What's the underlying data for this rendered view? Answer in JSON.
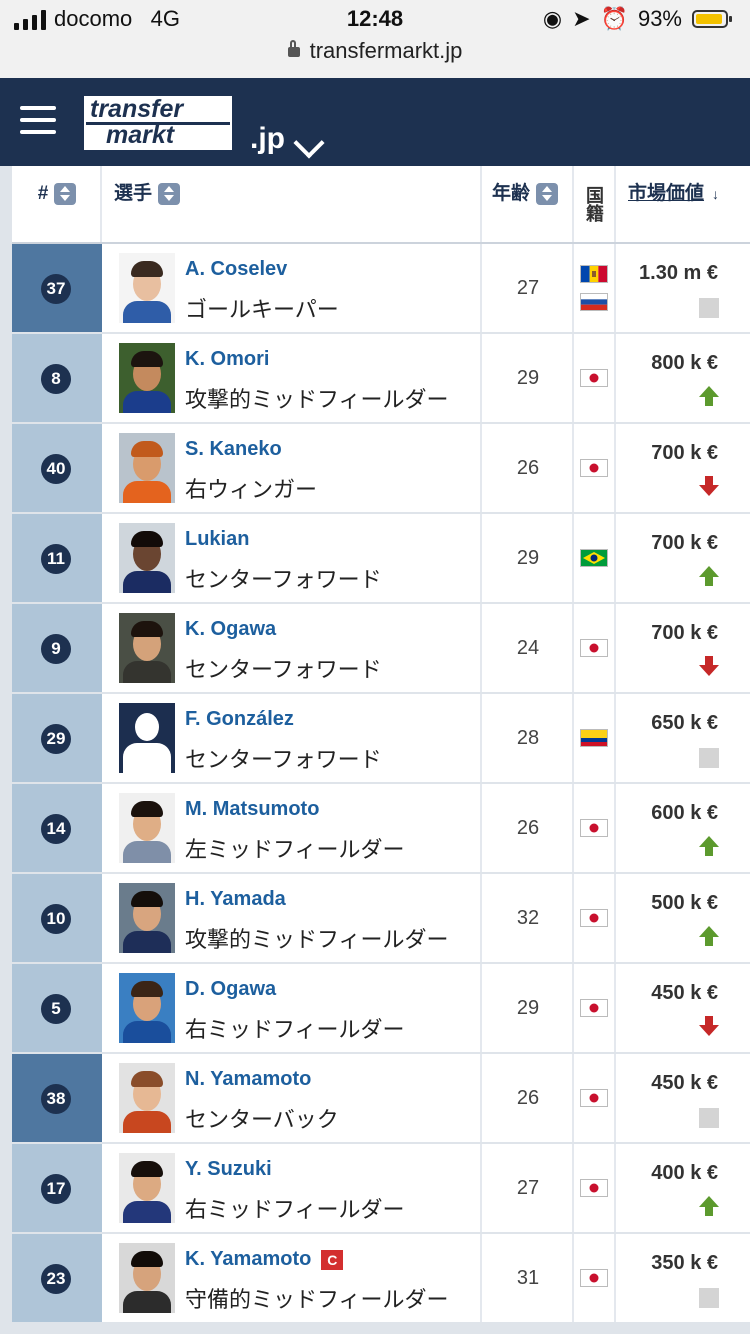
{
  "status_bar": {
    "carrier": "docomo",
    "network": "4G",
    "time": "12:48",
    "battery": "93%",
    "battery_level": 0.93
  },
  "browser": {
    "url": "transfermarkt.jp"
  },
  "site": {
    "logo_line1": "transfer",
    "logo_line2": "markt",
    "domain_suffix": ".jp"
  },
  "table": {
    "headers": {
      "number": "#",
      "player": "選手",
      "age": "年齢",
      "nationality": "国籍",
      "market_value": "市場価値"
    },
    "players": [
      {
        "number": "37",
        "name": "A. Coselev",
        "position": "ゴールキーパー",
        "age": "27",
        "flags": [
          "moldova",
          "russia"
        ],
        "value": "1.30 m €",
        "trend": "same",
        "row_color": "#4f77a0",
        "photo": {
          "bg": "#f4f4f4",
          "skin": "#e8bfa0",
          "hair": "#3a2a20",
          "shirt": "#2f5da8"
        }
      },
      {
        "number": "8",
        "name": "K. Omori",
        "position": "攻撃的ミッドフィールダー",
        "age": "29",
        "flags": [
          "japan"
        ],
        "value": "800 k €",
        "trend": "up",
        "row_color": "#afc5d8",
        "photo": {
          "bg": "#3d5f2e",
          "skin": "#c48a5e",
          "hair": "#1c140f",
          "shirt": "#1b3d8c"
        }
      },
      {
        "number": "40",
        "name": "S. Kaneko",
        "position": "右ウィンガー",
        "age": "26",
        "flags": [
          "japan"
        ],
        "value": "700 k €",
        "trend": "down",
        "row_color": "#afc5d8",
        "photo": {
          "bg": "#b9c3cc",
          "skin": "#d99b6c",
          "hair": "#c15a1c",
          "shirt": "#e4631e"
        }
      },
      {
        "number": "11",
        "name": "Lukian",
        "position": "センターフォワード",
        "age": "29",
        "flags": [
          "brazil"
        ],
        "value": "700 k €",
        "trend": "up",
        "row_color": "#afc5d8",
        "photo": {
          "bg": "#cfd6dc",
          "skin": "#6a4531",
          "hair": "#120b08",
          "shirt": "#1b2c62"
        }
      },
      {
        "number": "9",
        "name": "K. Ogawa",
        "position": "センターフォワード",
        "age": "24",
        "flags": [
          "japan"
        ],
        "value": "700 k €",
        "trend": "down",
        "row_color": "#afc5d8",
        "photo": {
          "bg": "#4a4f45",
          "skin": "#d4a27a",
          "hair": "#1d130d",
          "shirt": "#34342f"
        }
      },
      {
        "number": "29",
        "name": "F. González",
        "position": "センターフォワード",
        "age": "28",
        "flags": [
          "colombia"
        ],
        "value": "650 k €",
        "trend": "same",
        "row_color": "#afc5d8",
        "photo": {
          "bg": "#1c2e4f",
          "skin": "#ffffff",
          "hair": "#ffffff",
          "shirt": "#ffffff"
        }
      },
      {
        "number": "14",
        "name": "M. Matsumoto",
        "position": "左ミッドフィールダー",
        "age": "26",
        "flags": [
          "japan"
        ],
        "value": "600 k €",
        "trend": "up",
        "row_color": "#afc5d8",
        "photo": {
          "bg": "#f0f0f0",
          "skin": "#dfae86",
          "hair": "#1b120d",
          "shirt": "#7f8fa8"
        }
      },
      {
        "number": "10",
        "name": "H. Yamada",
        "position": "攻撃的ミッドフィールダー",
        "age": "32",
        "flags": [
          "japan"
        ],
        "value": "500 k €",
        "trend": "up",
        "row_color": "#afc5d8",
        "photo": {
          "bg": "#6a7c8c",
          "skin": "#d8a57f",
          "hair": "#140e0a",
          "shirt": "#1e2e58"
        }
      },
      {
        "number": "5",
        "name": "D. Ogawa",
        "position": "右ミッドフィールダー",
        "age": "29",
        "flags": [
          "japan"
        ],
        "value": "450 k €",
        "trend": "down",
        "row_color": "#afc5d8",
        "photo": {
          "bg": "#3a7fc2",
          "skin": "#d9a27a",
          "hair": "#3b2516",
          "shirt": "#1a4e9c"
        }
      },
      {
        "number": "38",
        "name": "N. Yamamoto",
        "position": "センターバック",
        "age": "26",
        "flags": [
          "japan"
        ],
        "value": "450 k €",
        "trend": "same",
        "row_color": "#4f77a0",
        "photo": {
          "bg": "#e2e2e2",
          "skin": "#e6b894",
          "hair": "#8a4d2a",
          "shirt": "#c8471f"
        }
      },
      {
        "number": "17",
        "name": "Y. Suzuki",
        "position": "右ミッドフィールダー",
        "age": "27",
        "flags": [
          "japan"
        ],
        "value": "400 k €",
        "trend": "up",
        "row_color": "#afc5d8",
        "photo": {
          "bg": "#e9e9e9",
          "skin": "#dcaa82",
          "hair": "#170f0b",
          "shirt": "#23377a"
        }
      },
      {
        "number": "23",
        "name": "K. Yamamoto",
        "position": "守備的ミッドフィールダー",
        "age": "31",
        "flags": [
          "japan"
        ],
        "value": "350 k €",
        "trend": "same",
        "captain": "C",
        "row_color": "#afc5d8",
        "photo": {
          "bg": "#d8d8d8",
          "skin": "#d6a37c",
          "hair": "#120c08",
          "shirt": "#2c2c2c"
        }
      }
    ]
  }
}
